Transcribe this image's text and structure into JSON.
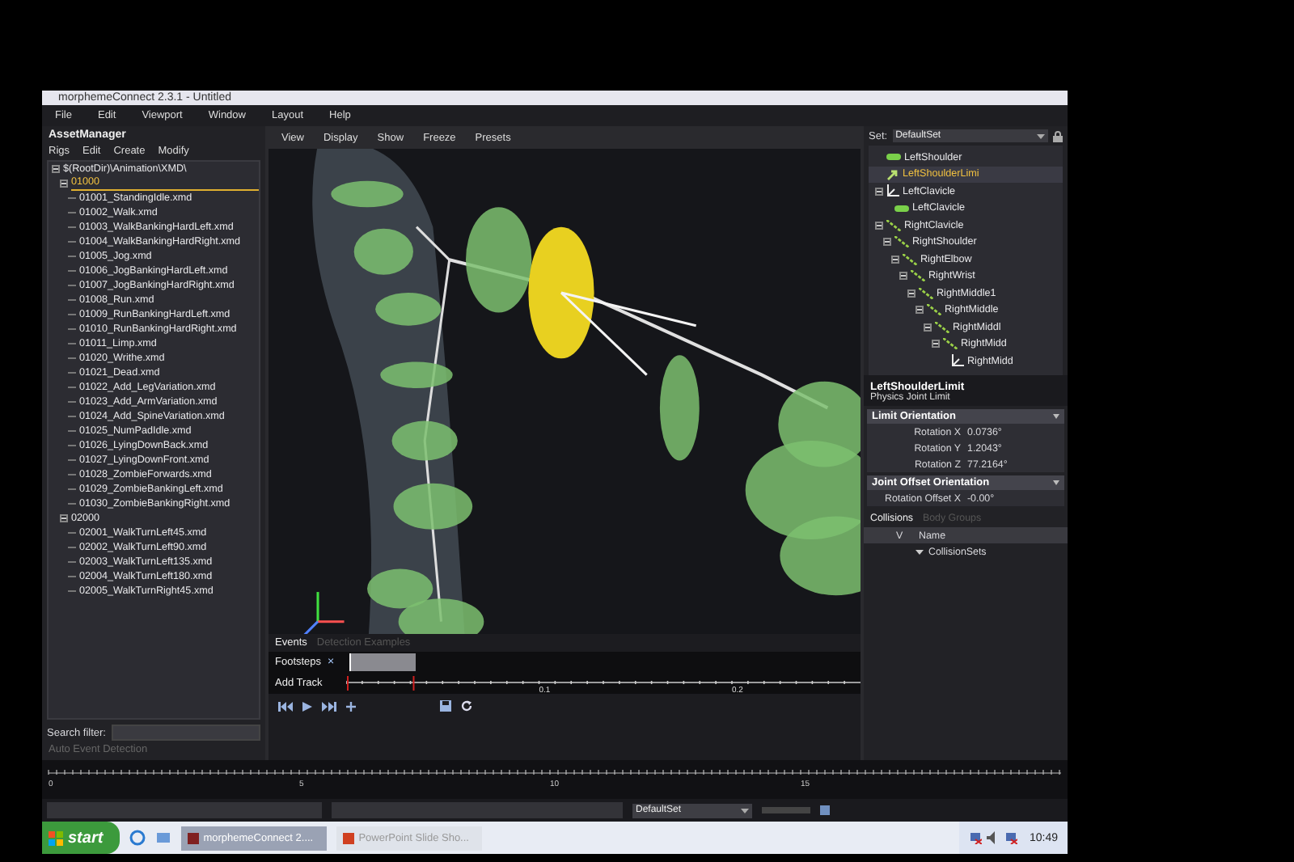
{
  "window": {
    "title": "morphemeConnect 2.3.1 - Untitled"
  },
  "menu": [
    "File",
    "Edit",
    "Viewport",
    "Window",
    "Layout",
    "Help"
  ],
  "asset_manager": {
    "title": "AssetManager",
    "menu": [
      "Rigs",
      "Edit",
      "Create",
      "Modify"
    ],
    "tree": [
      {
        "label": "$(RootDir)\\Animation\\XMD\\",
        "expanded": true,
        "selected": false,
        "children": [
          {
            "label": "01000",
            "expanded": true,
            "selected": true,
            "children": [
              {
                "label": "01001_StandingIdle.xmd",
                "selected": false
              },
              {
                "label": "01002_Walk.xmd",
                "selected": false
              },
              {
                "label": "01003_WalkBankingHardLeft.xmd",
                "selected": false
              },
              {
                "label": "01004_WalkBankingHardRight.xmd",
                "selected": false
              },
              {
                "label": "01005_Jog.xmd",
                "selected": false
              },
              {
                "label": "01006_JogBankingHardLeft.xmd",
                "selected": false
              },
              {
                "label": "01007_JogBankingHardRight.xmd",
                "selected": false
              },
              {
                "label": "01008_Run.xmd",
                "selected": false
              },
              {
                "label": "01009_RunBankingHardLeft.xmd",
                "selected": false
              },
              {
                "label": "01010_RunBankingHardRight.xmd",
                "selected": false
              },
              {
                "label": "01011_Limp.xmd",
                "selected": false
              },
              {
                "label": "01020_Writhe.xmd",
                "selected": false
              },
              {
                "label": "01021_Dead.xmd",
                "selected": false
              },
              {
                "label": "01022_Add_LegVariation.xmd",
                "selected": false
              },
              {
                "label": "01023_Add_ArmVariation.xmd",
                "selected": false
              },
              {
                "label": "01024_Add_SpineVariation.xmd",
                "selected": false
              },
              {
                "label": "01025_NumPadIdle.xmd",
                "selected": false
              },
              {
                "label": "01026_LyingDownBack.xmd",
                "selected": false
              },
              {
                "label": "01027_LyingDownFront.xmd",
                "selected": false
              },
              {
                "label": "01028_ZombieForwards.xmd",
                "selected": false
              },
              {
                "label": "01029_ZombieBankingLeft.xmd",
                "selected": false
              },
              {
                "label": "01030_ZombieBankingRight.xmd",
                "selected": false
              }
            ]
          },
          {
            "label": "02000",
            "expanded": true,
            "selected": false,
            "children": [
              {
                "label": "02001_WalkTurnLeft45.xmd",
                "selected": false
              },
              {
                "label": "02002_WalkTurnLeft90.xmd",
                "selected": false
              },
              {
                "label": "02003_WalkTurnLeft135.xmd",
                "selected": false
              },
              {
                "label": "02004_WalkTurnLeft180.xmd",
                "selected": false
              },
              {
                "label": "02005_WalkTurnRight45.xmd",
                "selected": false
              }
            ]
          }
        ]
      }
    ],
    "search_label": "Search filter:",
    "auto_event": {
      "label": "Auto Event Detection",
      "disabled": true
    }
  },
  "viewport": {
    "toolbar": [
      "View",
      "Display",
      "Show",
      "Freeze",
      "Presets"
    ]
  },
  "events": {
    "tabs": [
      {
        "label": "Events",
        "selected": true
      },
      {
        "label": "Detection Examples",
        "selected": false
      }
    ],
    "tracks": [
      {
        "label": "Footsteps",
        "kind": "track",
        "close": "×"
      },
      {
        "label": "Add Track",
        "kind": "add"
      }
    ],
    "ruler_labels": [
      "0.1",
      "0.2"
    ]
  },
  "rig": {
    "set_label": "Set:",
    "set_value": "DefaultSet",
    "hierarchy": [
      {
        "label": "LeftShoulder",
        "kind": "body",
        "selected": false
      },
      {
        "label": "LeftShoulderLimi",
        "kind": "limit",
        "selected": true
      },
      {
        "label": "LeftClavicle",
        "kind": "joint",
        "selected": false,
        "expanded": true,
        "children": [
          {
            "label": "LeftClavicle",
            "kind": "body",
            "selected": false
          }
        ]
      },
      {
        "label": "RightClavicle",
        "kind": "bone",
        "selected": false,
        "expanded": true,
        "children": [
          {
            "label": "RightShoulder",
            "kind": "bone",
            "selected": false,
            "expanded": true,
            "children": [
              {
                "label": "RightElbow",
                "kind": "bone",
                "selected": false,
                "expanded": true,
                "children": [
                  {
                    "label": "RightWrist",
                    "kind": "bone",
                    "selected": false,
                    "expanded": true,
                    "children": [
                      {
                        "label": "RightMiddle1",
                        "kind": "bone",
                        "selected": false,
                        "expanded": true,
                        "children": [
                          {
                            "label": "RightMiddle",
                            "kind": "bone",
                            "selected": false,
                            "expanded": true,
                            "children": [
                              {
                                "label": "RightMiddl",
                                "kind": "bone",
                                "selected": false,
                                "expanded": true,
                                "children": [
                                  {
                                    "label": "RightMidd",
                                    "kind": "bone",
                                    "selected": false,
                                    "expanded": true,
                                    "children": [
                                      {
                                        "label": "RightMidd",
                                        "kind": "joint",
                                        "selected": false
                                      }
                                    ]
                                  }
                                ]
                              }
                            ]
                          }
                        ]
                      }
                    ]
                  }
                ]
              }
            ]
          }
        ]
      }
    ],
    "properties": {
      "name": "LeftShoulderLimit",
      "type": "Physics Joint Limit",
      "sections": [
        {
          "title": "Limit Orientation",
          "rows": [
            {
              "label": "Rotation X",
              "value": "0.0736°"
            },
            {
              "label": "Rotation Y",
              "value": "1.2043°"
            },
            {
              "label": "Rotation Z",
              "value": "77.2164°"
            }
          ]
        },
        {
          "title": "Joint Offset Orientation",
          "rows": [
            {
              "label": "Rotation Offset X",
              "value": "-0.00°"
            }
          ]
        }
      ]
    },
    "collision_tabs": [
      {
        "label": "Collisions",
        "selected": true
      },
      {
        "label": "Body Groups",
        "selected": false
      }
    ],
    "collision_columns": [
      "V",
      "Name"
    ],
    "collision_rows": [
      {
        "name": "CollisionSets",
        "expanded": true
      }
    ]
  },
  "timeline": {
    "labels": [
      "0",
      "5",
      "10",
      "15"
    ]
  },
  "status_bar": {
    "set_value": "DefaultSet"
  },
  "taskbar": {
    "start": "start",
    "tasks": [
      {
        "label": "morphemeConnect 2....",
        "selected": true
      },
      {
        "label": "PowerPoint Slide Sho...",
        "selected": false
      }
    ],
    "clock": "10:49"
  }
}
